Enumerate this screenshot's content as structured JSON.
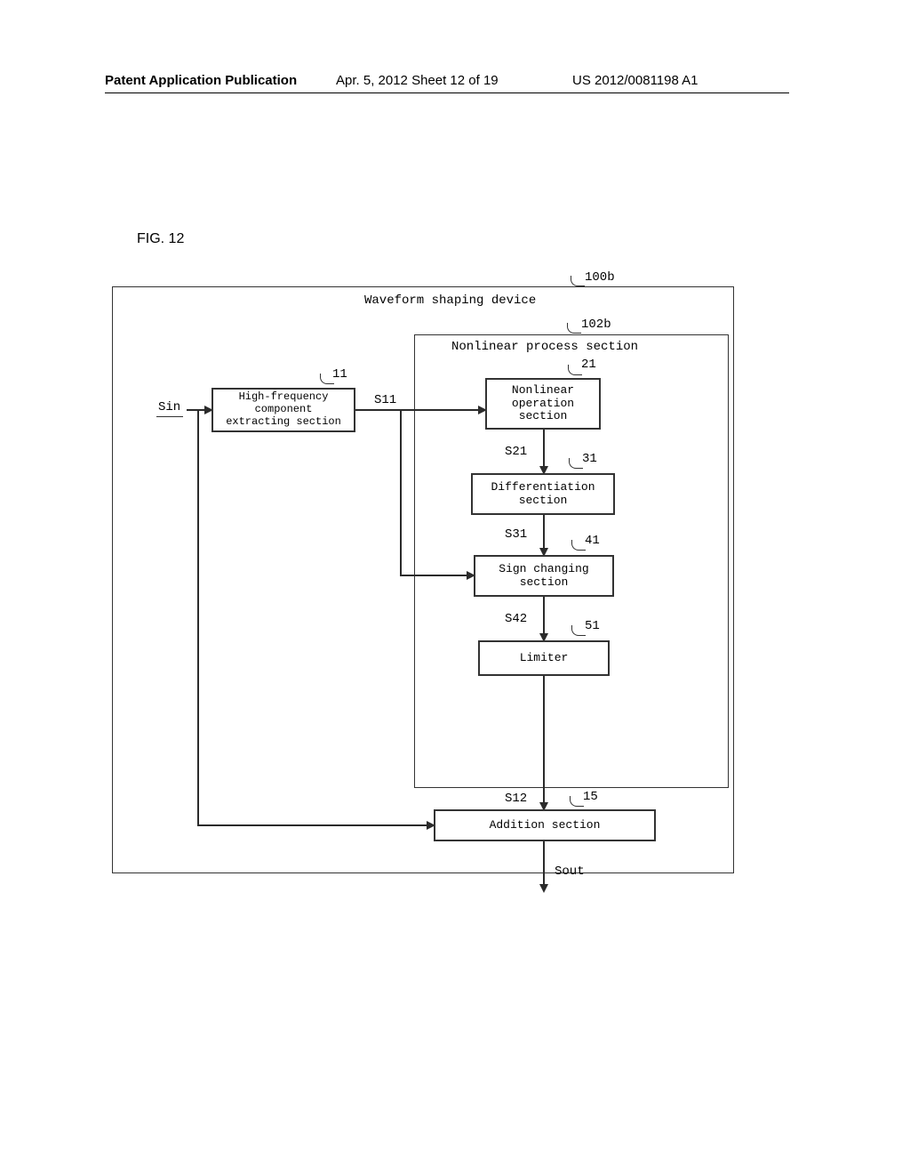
{
  "header": {
    "left": "Patent Application Publication",
    "mid": "Apr. 5, 2012   Sheet 12 of 19",
    "right": "US 2012/0081198 A1"
  },
  "fig_label": "FIG. 12",
  "refs": {
    "outer": "100b",
    "nl_section": "102b",
    "hfc": "11",
    "nlo": "21",
    "diff": "31",
    "sign": "41",
    "limiter": "51",
    "addition": "15"
  },
  "box_titles": {
    "outer": "Waveform shaping device",
    "nl_section": "Nonlinear process section",
    "hfc_l1": "High-frequency",
    "hfc_l2": "component",
    "hfc_l3": "extracting section",
    "nlo_l1": "Nonlinear",
    "nlo_l2": "operation",
    "nlo_l3": "section",
    "diff_l1": "Differentiation",
    "diff_l2": "section",
    "sign_l1": "Sign changing",
    "sign_l2": "section",
    "limiter": "Limiter",
    "addition": "Addition section"
  },
  "signals": {
    "sin": "Sin",
    "sout": "Sout",
    "s11": "S11",
    "s21": "S21",
    "s31": "S31",
    "s42": "S42",
    "s12": "S12"
  }
}
